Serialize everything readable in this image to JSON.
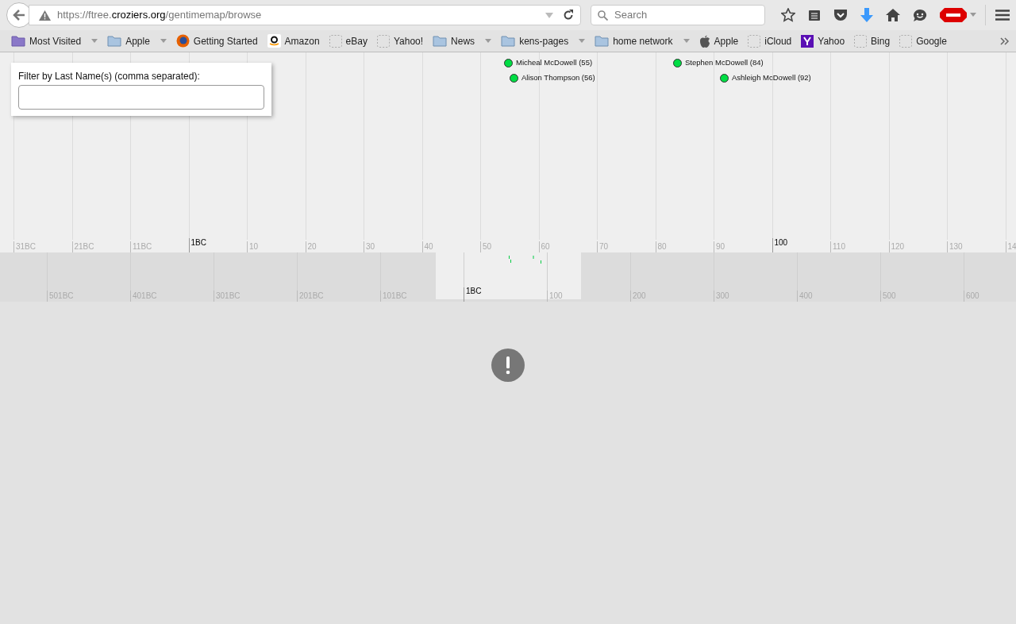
{
  "toolbar": {
    "url": {
      "prefix": "https://ftree.",
      "domain": "croziers.org",
      "path": "/gentimemap/browse"
    },
    "search": {
      "placeholder": "Search"
    }
  },
  "bookmarks": [
    {
      "kind": "smart",
      "label": "Most Visited",
      "menu": true
    },
    {
      "kind": "folder",
      "label": "Apple",
      "menu": true
    },
    {
      "kind": "firefox",
      "label": "Getting Started",
      "menu": false
    },
    {
      "kind": "amazon",
      "label": "Amazon",
      "menu": false
    },
    {
      "kind": "blank",
      "label": "eBay",
      "menu": false
    },
    {
      "kind": "blank",
      "label": "Yahoo!",
      "menu": false
    },
    {
      "kind": "folder",
      "label": "News",
      "menu": true
    },
    {
      "kind": "folder",
      "label": "kens-pages",
      "menu": true
    },
    {
      "kind": "folder",
      "label": "home network",
      "menu": true
    },
    {
      "kind": "apple",
      "label": "Apple",
      "menu": false
    },
    {
      "kind": "blank",
      "label": "iCloud",
      "menu": false
    },
    {
      "kind": "yahoo",
      "label": "Yahoo",
      "menu": false
    },
    {
      "kind": "blank",
      "label": "Bing",
      "menu": false
    },
    {
      "kind": "blank",
      "label": "Google",
      "menu": false
    }
  ],
  "filter": {
    "label": "Filter by Last Name(s) (comma separated):"
  },
  "timeline": {
    "ticks": [
      {
        "label": "31BC",
        "major": false
      },
      {
        "label": "21BC",
        "major": false
      },
      {
        "label": "11BC",
        "major": false
      },
      {
        "label": "1BC",
        "major": true
      },
      {
        "label": "10",
        "major": false
      },
      {
        "label": "20",
        "major": false
      },
      {
        "label": "30",
        "major": false
      },
      {
        "label": "40",
        "major": false
      },
      {
        "label": "50",
        "major": false
      },
      {
        "label": "60",
        "major": false
      },
      {
        "label": "70",
        "major": false
      },
      {
        "label": "80",
        "major": false
      },
      {
        "label": "90",
        "major": false
      },
      {
        "label": "100",
        "major": true
      },
      {
        "label": "110",
        "major": false
      },
      {
        "label": "120",
        "major": false
      },
      {
        "label": "130",
        "major": false
      },
      {
        "label": "14",
        "major": false
      }
    ],
    "events": [
      {
        "label": "Micheal McDowell (55)",
        "color": "#00dd44"
      },
      {
        "label": "Alison Thompson (56)",
        "color": "#00dd44"
      },
      {
        "label": "Stephen McDowell (84)",
        "color": "#00dd44"
      },
      {
        "label": "Ashleigh McDowell (92)",
        "color": "#00dd44"
      }
    ]
  },
  "overview": {
    "ticks": [
      {
        "label": "501BC",
        "major": false
      },
      {
        "label": "401BC",
        "major": false
      },
      {
        "label": "301BC",
        "major": false
      },
      {
        "label": "201BC",
        "major": false
      },
      {
        "label": "101BC",
        "major": false
      },
      {
        "label": "1BC",
        "major": true
      },
      {
        "label": "100",
        "major": false
      },
      {
        "label": "200",
        "major": false
      },
      {
        "label": "300",
        "major": false
      },
      {
        "label": "400",
        "major": false
      },
      {
        "label": "500",
        "major": false
      },
      {
        "label": "600",
        "major": false
      }
    ]
  }
}
